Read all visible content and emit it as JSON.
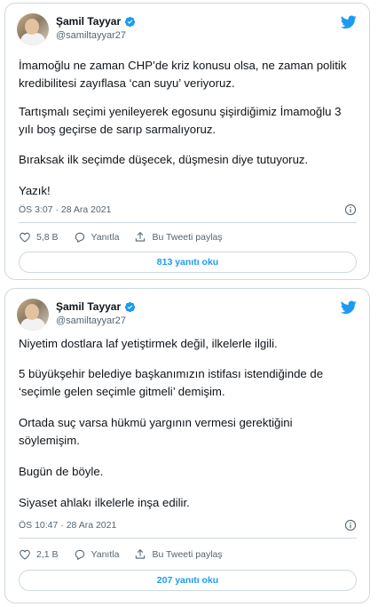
{
  "colors": {
    "accent": "#1d9bf0",
    "muted": "#536471",
    "text": "#0f1419",
    "border": "#cfd9de"
  },
  "tweets": [
    {
      "author": {
        "name": "Şamil Tayyar",
        "handle": "@samiltayyar27",
        "verified": true
      },
      "paragraphs": [
        "İmamoğlu ne zaman CHP’de kriz konusu olsa, ne zaman politik kredibilitesi zayıflasa ‘can suyu’ veriyoruz.",
        "Tartışmalı seçimi yenileyerek egosunu şişirdiğimiz İmamoğlu 3 yılı boş geçirse de sarıp sarmalıyoruz.",
        "Bıraksak ilk seçimde düşecek, düşmesin diye tutuyoruz.",
        "Yazık!"
      ],
      "timestamp": "ÖS 3:07 · 28 Ara 2021",
      "likes": "5,8 B",
      "reply_label": "Yanıtla",
      "share_label": "Bu Tweeti paylaş",
      "read_replies": "813 yanıtı oku"
    },
    {
      "author": {
        "name": "Şamil Tayyar",
        "handle": "@samiltayyar27",
        "verified": true
      },
      "paragraphs": [
        "Niyetim dostlara laf yetiştirmek değil, ilkelerle ilgili.",
        "5 büyükşehir belediye başkanımızın istifası istendiğinde de ‘seçimle gelen seçimle gitmeli’ demişim.",
        "Ortada suç varsa hükmü yargının vermesi gerektiğini söylemişim.",
        "Bugün de böyle.",
        "Siyaset ahlakı ilkelerle inşa edilir."
      ],
      "timestamp": "ÖS 10:47 · 28 Ara 2021",
      "likes": "2,1 B",
      "reply_label": "Yanıtla",
      "share_label": "Bu Tweeti paylaş",
      "read_replies": "207 yanıtı oku"
    }
  ]
}
